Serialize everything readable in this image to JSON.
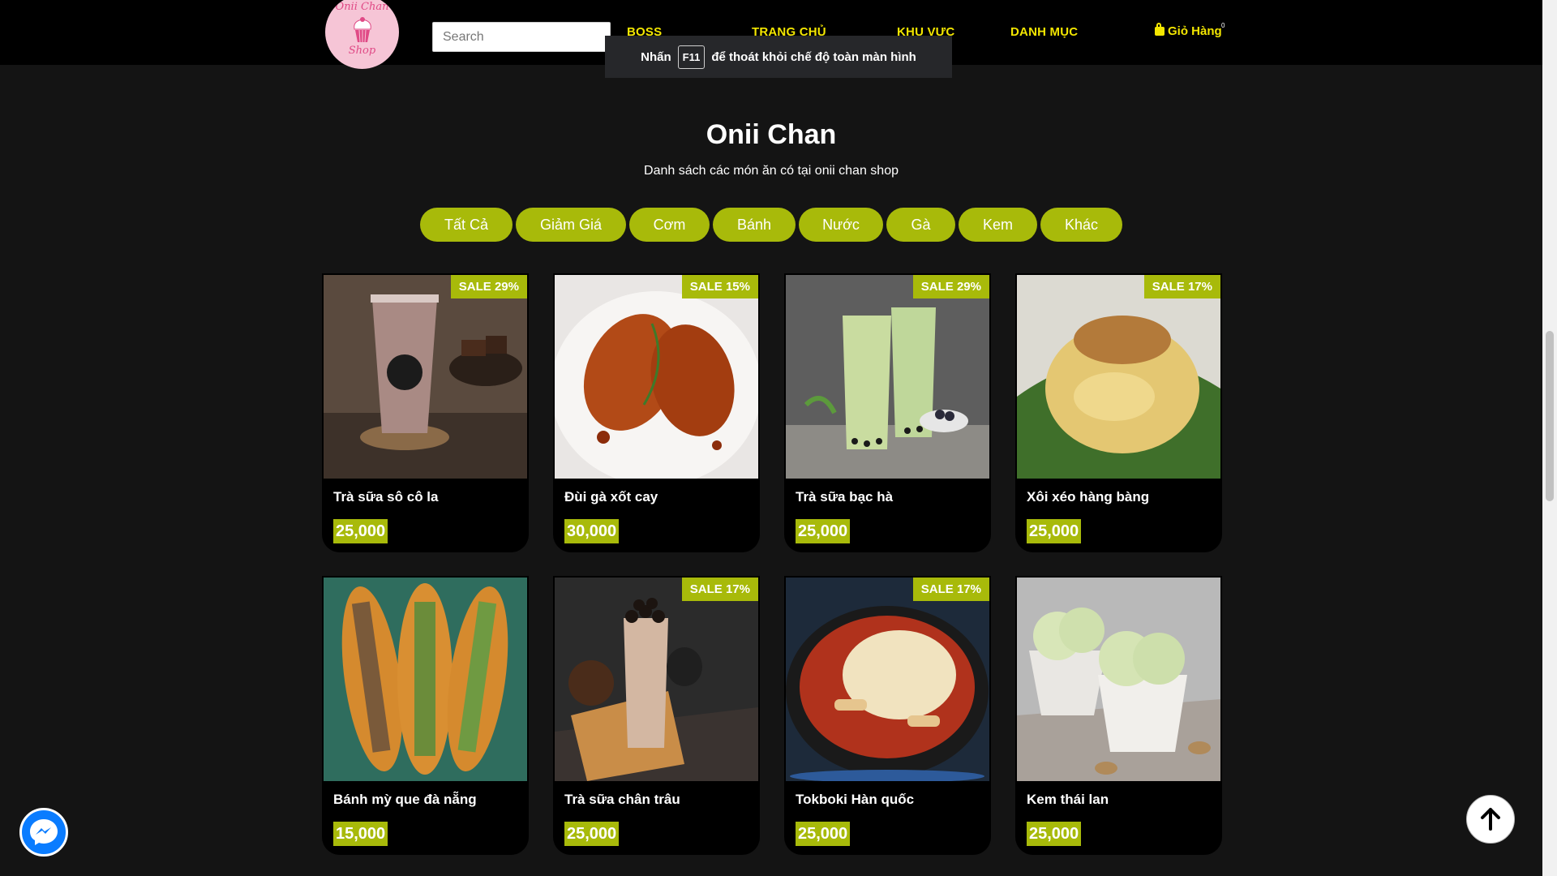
{
  "header": {
    "logo_line1": "Onii Chan",
    "logo_line2": "Shop",
    "search_placeholder": "Search",
    "nav": [
      "BOSS",
      "TRANG CHỦ",
      "KHU VỰC",
      "DANH MỤC"
    ],
    "cart_label": "Giỏ Hàng",
    "cart_count": "0"
  },
  "toast": {
    "before": "Nhấn",
    "key": "F11",
    "after": "để thoát khỏi chế độ toàn màn hình"
  },
  "main": {
    "title": "Onii Chan",
    "subtitle": "Danh sách các món ăn có tại onii chan shop",
    "filters": [
      "Tất Cả",
      "Giảm Giá",
      "Cơm",
      "Bánh",
      "Nước",
      "Gà",
      "Kem",
      "Khác"
    ]
  },
  "products": [
    {
      "name": "Trà sữa sô cô la",
      "price": "25,000",
      "sale": "SALE 29%"
    },
    {
      "name": "Đùi gà xốt cay",
      "price": "30,000",
      "sale": "SALE 15%"
    },
    {
      "name": "Trà sữa bạc hà",
      "price": "25,000",
      "sale": "SALE 29%"
    },
    {
      "name": "Xôi xéo hàng bàng",
      "price": "25,000",
      "sale": "SALE 17%"
    },
    {
      "name": "Bánh mỳ que đà nẵng",
      "price": "15,000",
      "sale": ""
    },
    {
      "name": "Trà sữa chân trâu",
      "price": "25,000",
      "sale": "SALE 17%"
    },
    {
      "name": "Tokboki Hàn quốc",
      "price": "25,000",
      "sale": "SALE 17%"
    },
    {
      "name": "Kem thái lan",
      "price": "25,000",
      "sale": ""
    }
  ],
  "colors": {
    "accent": "#a8ba0a",
    "nav": "#f3e600",
    "background": "#141414"
  }
}
